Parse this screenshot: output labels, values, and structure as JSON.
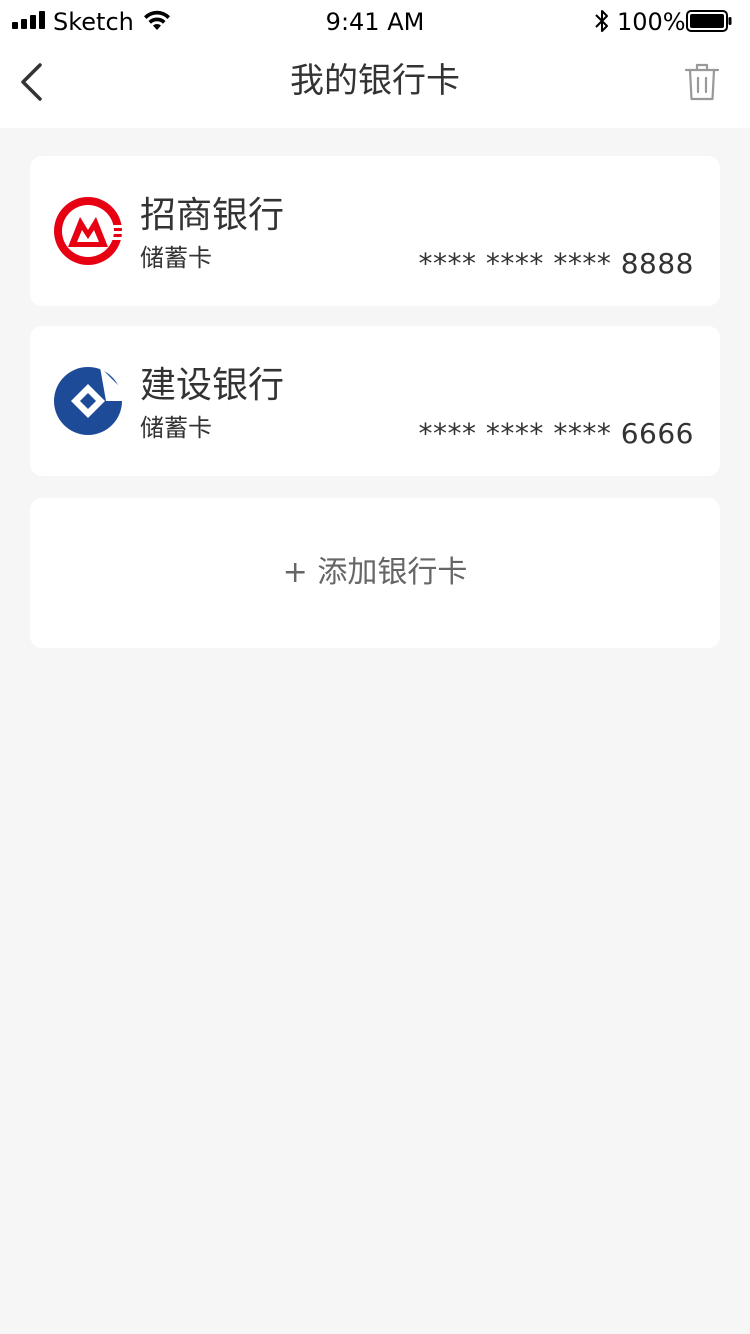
{
  "status_bar": {
    "carrier": "Sketch",
    "time": "9:41 AM",
    "battery": "100%"
  },
  "nav": {
    "title": "我的银行卡",
    "back_icon": "chevron-left-icon",
    "delete_icon": "trash-icon"
  },
  "cards": [
    {
      "bank_name": "招商银行",
      "card_type": "储蓄卡",
      "number": "**** **** **** 8888",
      "logo_icon": "cmb-logo",
      "brand_color": "#e60012"
    },
    {
      "bank_name": "建设银行",
      "card_type": "储蓄卡",
      "number": "**** **** **** 6666",
      "logo_icon": "ccb-logo",
      "brand_color": "#1d4b98"
    }
  ],
  "add_card_label": "+ 添加银行卡",
  "colors": {
    "background": "#f6f6f6",
    "surface": "#ffffff",
    "text": "#333333",
    "muted_text": "#666666"
  }
}
